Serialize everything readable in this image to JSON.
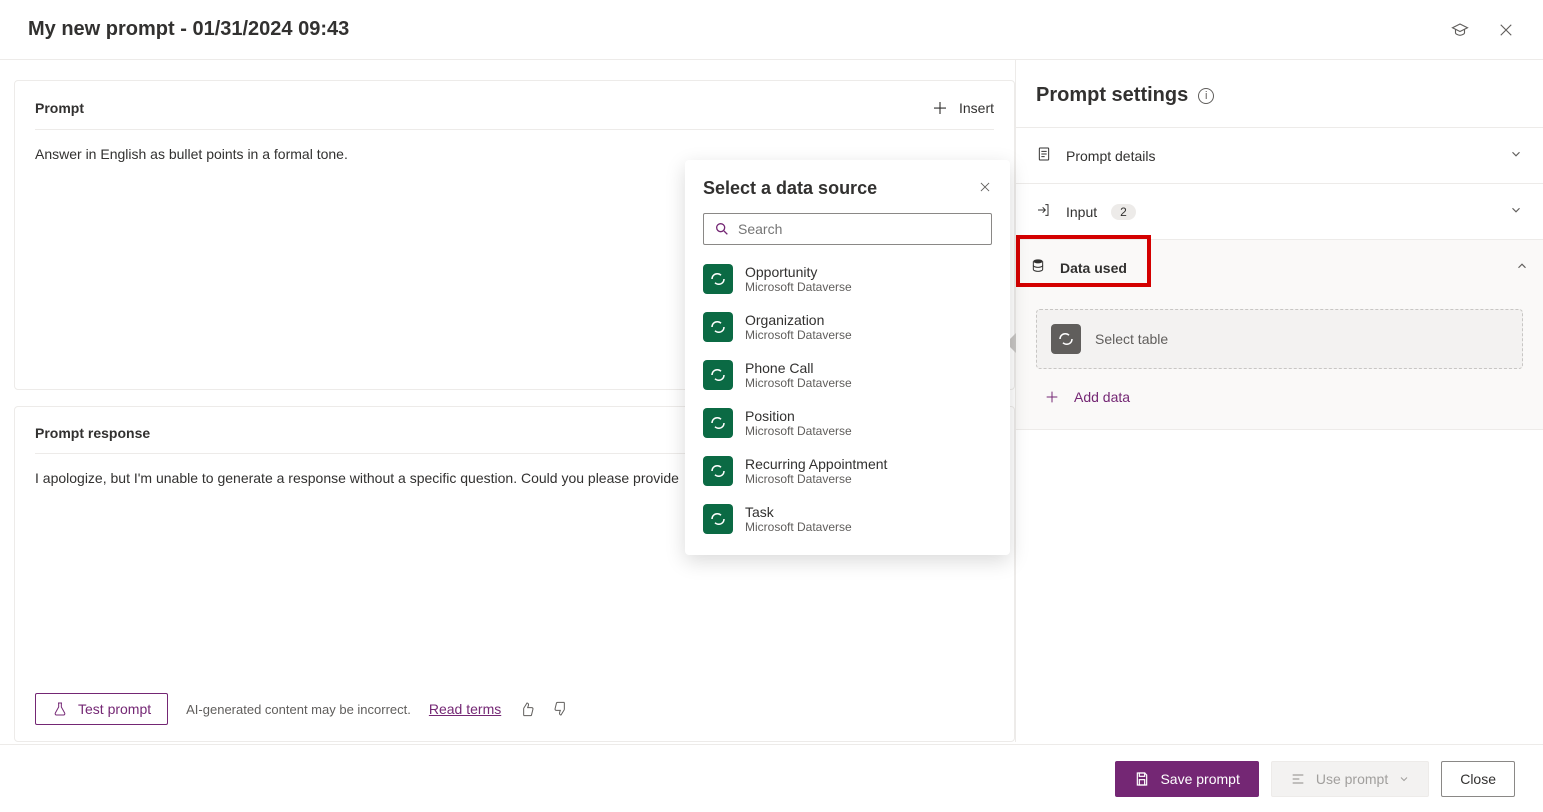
{
  "header": {
    "title": "My new prompt - 01/31/2024 09:43"
  },
  "prompt_card": {
    "title": "Prompt",
    "insert_label": "Insert",
    "content": "Answer in English as bullet points in a formal tone."
  },
  "response_card": {
    "title": "Prompt response",
    "content": "I apologize, but I'm unable to generate a response without a specific question. Could you please provide",
    "test_label": "Test prompt",
    "disclaimer": "AI-generated content may be incorrect.",
    "read_terms": "Read terms"
  },
  "popover": {
    "title": "Select a data source",
    "search_placeholder": "Search",
    "items": [
      {
        "name": "Opportunity",
        "sub": "Microsoft Dataverse"
      },
      {
        "name": "Organization",
        "sub": "Microsoft Dataverse"
      },
      {
        "name": "Phone Call",
        "sub": "Microsoft Dataverse"
      },
      {
        "name": "Position",
        "sub": "Microsoft Dataverse"
      },
      {
        "name": "Recurring Appointment",
        "sub": "Microsoft Dataverse"
      },
      {
        "name": "Task",
        "sub": "Microsoft Dataverse"
      }
    ]
  },
  "settings": {
    "title": "Prompt settings",
    "prompt_details": "Prompt details",
    "input_label": "Input",
    "input_count": "2",
    "data_used": "Data used",
    "select_table": "Select table",
    "add_data": "Add data"
  },
  "footer": {
    "save": "Save prompt",
    "use": "Use prompt",
    "close": "Close"
  }
}
